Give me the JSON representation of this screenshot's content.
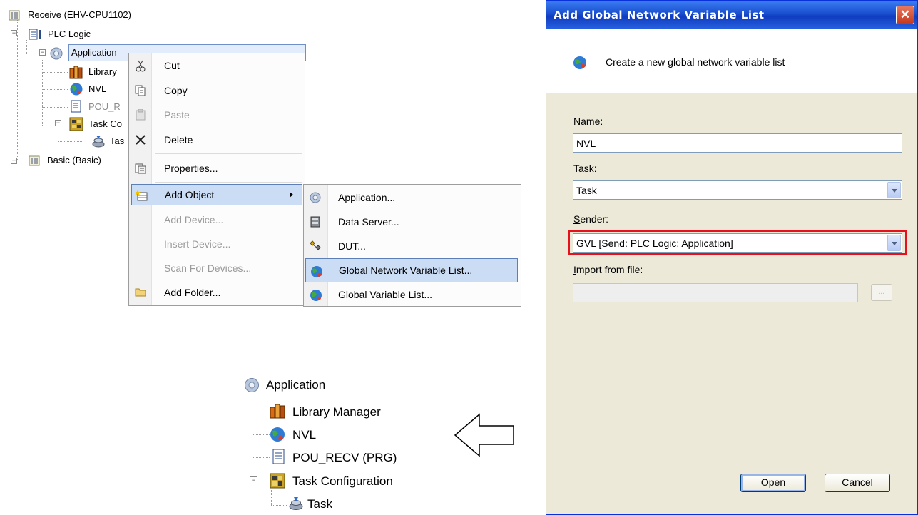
{
  "tree": {
    "root": "Receive (EHV-CPU1102)",
    "plc_logic": "PLC Logic",
    "application": "Application",
    "library_manager": "Library",
    "nvl": "NVL",
    "pou": "POU_R",
    "task_config": "Task Co",
    "task": "Tas",
    "basic": "Basic (Basic)"
  },
  "context_menu": {
    "items": [
      {
        "label": "Cut",
        "icon": "scissors-icon"
      },
      {
        "label": "Copy",
        "icon": "copy-icon"
      },
      {
        "label": "Paste",
        "icon": "paste-icon"
      },
      {
        "label": "Delete",
        "icon": "delete-icon"
      },
      {
        "label": "Properties...",
        "icon": "properties-icon"
      },
      {
        "label": "Add Object",
        "icon": "add-object-icon"
      },
      {
        "label": "Add Device..."
      },
      {
        "label": "Insert Device..."
      },
      {
        "label": "Scan For Devices..."
      },
      {
        "label": "Add Folder...",
        "icon": "folder-icon"
      }
    ]
  },
  "submenu": {
    "items": [
      {
        "label": "Application...",
        "icon": "gear-icon"
      },
      {
        "label": "Data Server...",
        "icon": "data-server-icon"
      },
      {
        "label": "DUT...",
        "icon": "dut-icon"
      },
      {
        "label": "Global Network Variable List...",
        "icon": "globe-icon"
      },
      {
        "label": "Global Variable List...",
        "icon": "globe-icon"
      }
    ]
  },
  "result_tree": {
    "application": "Application",
    "library_manager": "Library Manager",
    "nvl": "NVL",
    "pou": "POU_RECV (PRG)",
    "task_config": "Task Configuration",
    "task": "Task"
  },
  "dialog": {
    "title": "Add Global Network Variable List",
    "close": "✕",
    "header_text": "Create a new global network variable list",
    "name_label_u": "N",
    "name_label_rest": "ame:",
    "name_value": "NVL",
    "task_label_u": "T",
    "task_label_rest": "ask:",
    "task_value": "Task",
    "sender_label_u": "S",
    "sender_label_rest": "ender:",
    "sender_value": "GVL [Send: PLC Logic: Application]",
    "import_label_u": "I",
    "import_label_rest": "mport from file:",
    "import_value": "",
    "browse": "...",
    "open": "Open",
    "cancel": "Cancel"
  },
  "colors": {
    "highlight": "#cbdcf5",
    "titlebar": "#1a4fd0",
    "red_outline": "#e8101a"
  }
}
